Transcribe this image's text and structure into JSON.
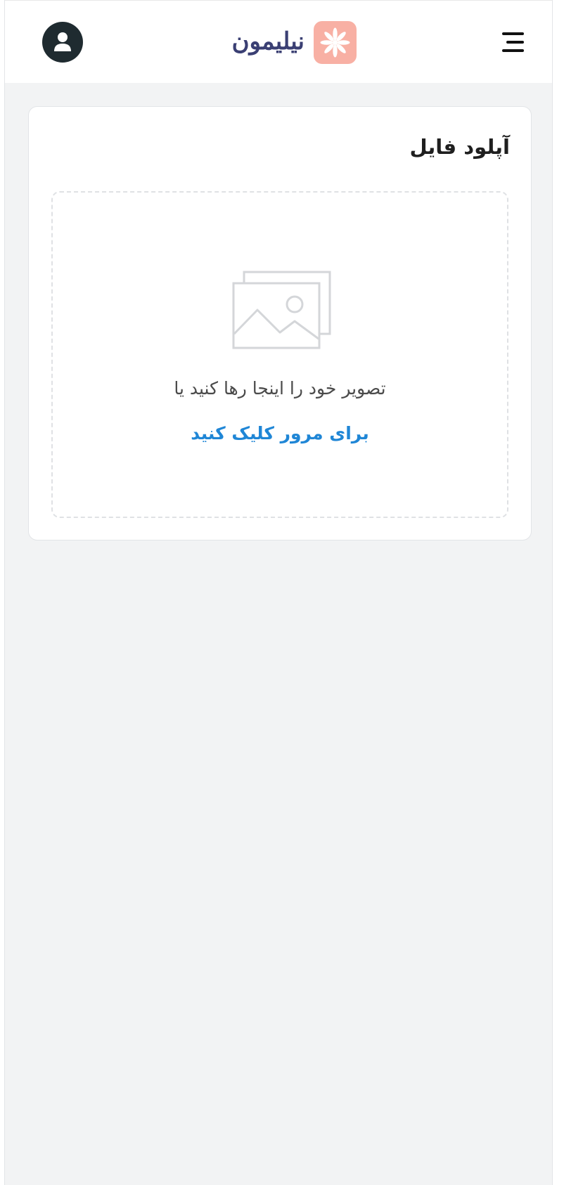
{
  "header": {
    "logo_text": "نیلیمون",
    "logo_icon": "sparkle-flower-icon",
    "menu_icon": "hamburger-menu-icon",
    "avatar_icon": "user-account-icon",
    "logo_mark_color": "#f8b0a4",
    "logo_text_color": "#3a3f73"
  },
  "upload": {
    "title": "آپلود فایل",
    "drop_text": "تصویر خود را اینجا رها کنید یا",
    "browse_link": "برای مرور کلیک کنید",
    "illustration_icon": "image-gallery-placeholder-icon",
    "link_color": "#1f86d6"
  }
}
